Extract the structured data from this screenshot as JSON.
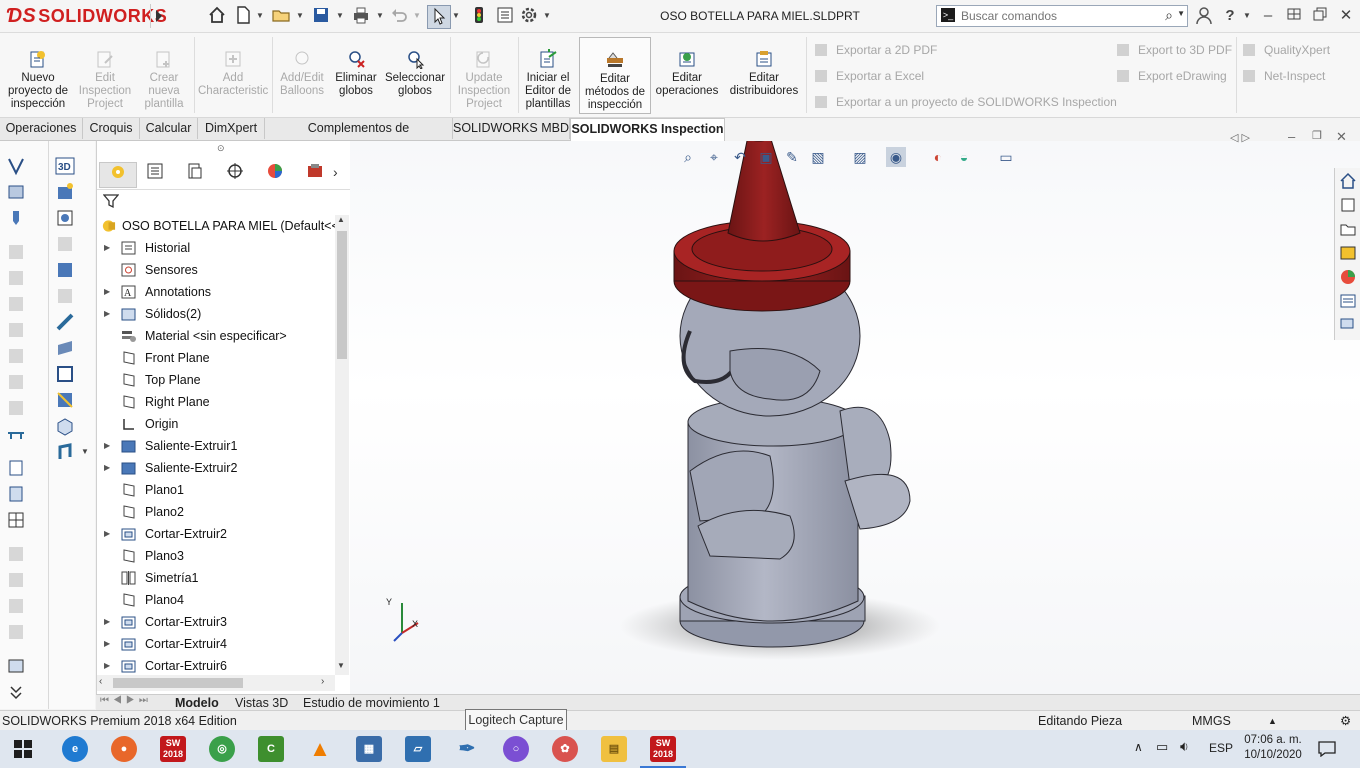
{
  "app": {
    "brand": "SOLIDWORKS",
    "document_title": "OSO BOTELLA PARA MIEL.SLDPRT",
    "search_placeholder": "Buscar comandos"
  },
  "command_manager": {
    "buttons": [
      {
        "label": "Nuevo proyecto de inspección",
        "enabled": true
      },
      {
        "label": "Edit Inspection Project",
        "enabled": false
      },
      {
        "label": "Crear nueva plantilla",
        "enabled": false
      },
      {
        "label": "Add Characteristic",
        "enabled": false
      },
      {
        "label": "Add/Edit Balloons",
        "enabled": false
      },
      {
        "label": "Eliminar globos",
        "enabled": true
      },
      {
        "label": "Seleccionar globos",
        "enabled": true
      },
      {
        "label": "Update Inspection Project",
        "enabled": false
      },
      {
        "label": "Iniciar el Editor de plantillas",
        "enabled": true
      },
      {
        "label": "Editar métodos de inspección",
        "enabled": true,
        "selected": true
      },
      {
        "label": "Editar operaciones",
        "enabled": true
      },
      {
        "label": "Editar distribuidores",
        "enabled": true
      }
    ],
    "export_2d_pdf": "Exportar a 2D PDF",
    "export_excel": "Exportar a Excel",
    "export_project": "Exportar a un proyecto de SOLIDWORKS Inspection",
    "export_3d_pdf": "Export to 3D PDF",
    "export_edrawing": "Export eDrawing",
    "qualityxpert": "QualityXpert",
    "net_inspect": "Net-Inspect"
  },
  "tabs": [
    "Operaciones",
    "Croquis",
    "Calcular",
    "DimXpert",
    "Complementos de SOLIDWORKS",
    "SOLIDWORKS MBD",
    "SOLIDWORKS Inspection"
  ],
  "active_tab": "SOLIDWORKS Inspection",
  "feature_tree": {
    "root": "OSO BOTELLA PARA MIEL  (Default<<De",
    "items": [
      {
        "label": "Historial",
        "expandable": true
      },
      {
        "label": "Sensores",
        "expandable": false
      },
      {
        "label": "Annotations",
        "expandable": true
      },
      {
        "label": "Sólidos(2)",
        "expandable": true
      },
      {
        "label": "Material <sin especificar>",
        "expandable": false
      },
      {
        "label": "Front Plane",
        "expandable": false
      },
      {
        "label": "Top Plane",
        "expandable": false
      },
      {
        "label": "Right Plane",
        "expandable": false
      },
      {
        "label": "Origin",
        "expandable": false
      },
      {
        "label": "Saliente-Extruir1",
        "expandable": true
      },
      {
        "label": "Saliente-Extruir2",
        "expandable": true
      },
      {
        "label": "Plano1",
        "expandable": false
      },
      {
        "label": "Plano2",
        "expandable": false
      },
      {
        "label": "Cortar-Extruir2",
        "expandable": true
      },
      {
        "label": "Plano3",
        "expandable": false
      },
      {
        "label": "Simetría1",
        "expandable": false
      },
      {
        "label": "Plano4",
        "expandable": false
      },
      {
        "label": "Cortar-Extruir3",
        "expandable": true
      },
      {
        "label": "Cortar-Extruir4",
        "expandable": true
      },
      {
        "label": "Cortar-Extruir6",
        "expandable": true
      }
    ]
  },
  "bottom_tabs": [
    "Modelo",
    "Vistas 3D",
    "Estudio de movimiento 1"
  ],
  "active_bottom_tab": "Modelo",
  "status": {
    "edition": "SOLIDWORKS Premium 2018 x64 Edition",
    "tooltip": "Logitech Capture",
    "mode": "Editando Pieza",
    "units": "MMGS"
  },
  "taskbar": {
    "language": "ESP",
    "time": "07:06 a. m.",
    "date": "10/10/2020",
    "sw_badge": "2018"
  },
  "triad": {
    "x": "X",
    "y": "Y"
  },
  "colors": {
    "brand_red": "#d02020",
    "cap_red": "#8c1a1a",
    "body_grey": "#9ea3b3",
    "accent_blue": "#2a4f86"
  }
}
